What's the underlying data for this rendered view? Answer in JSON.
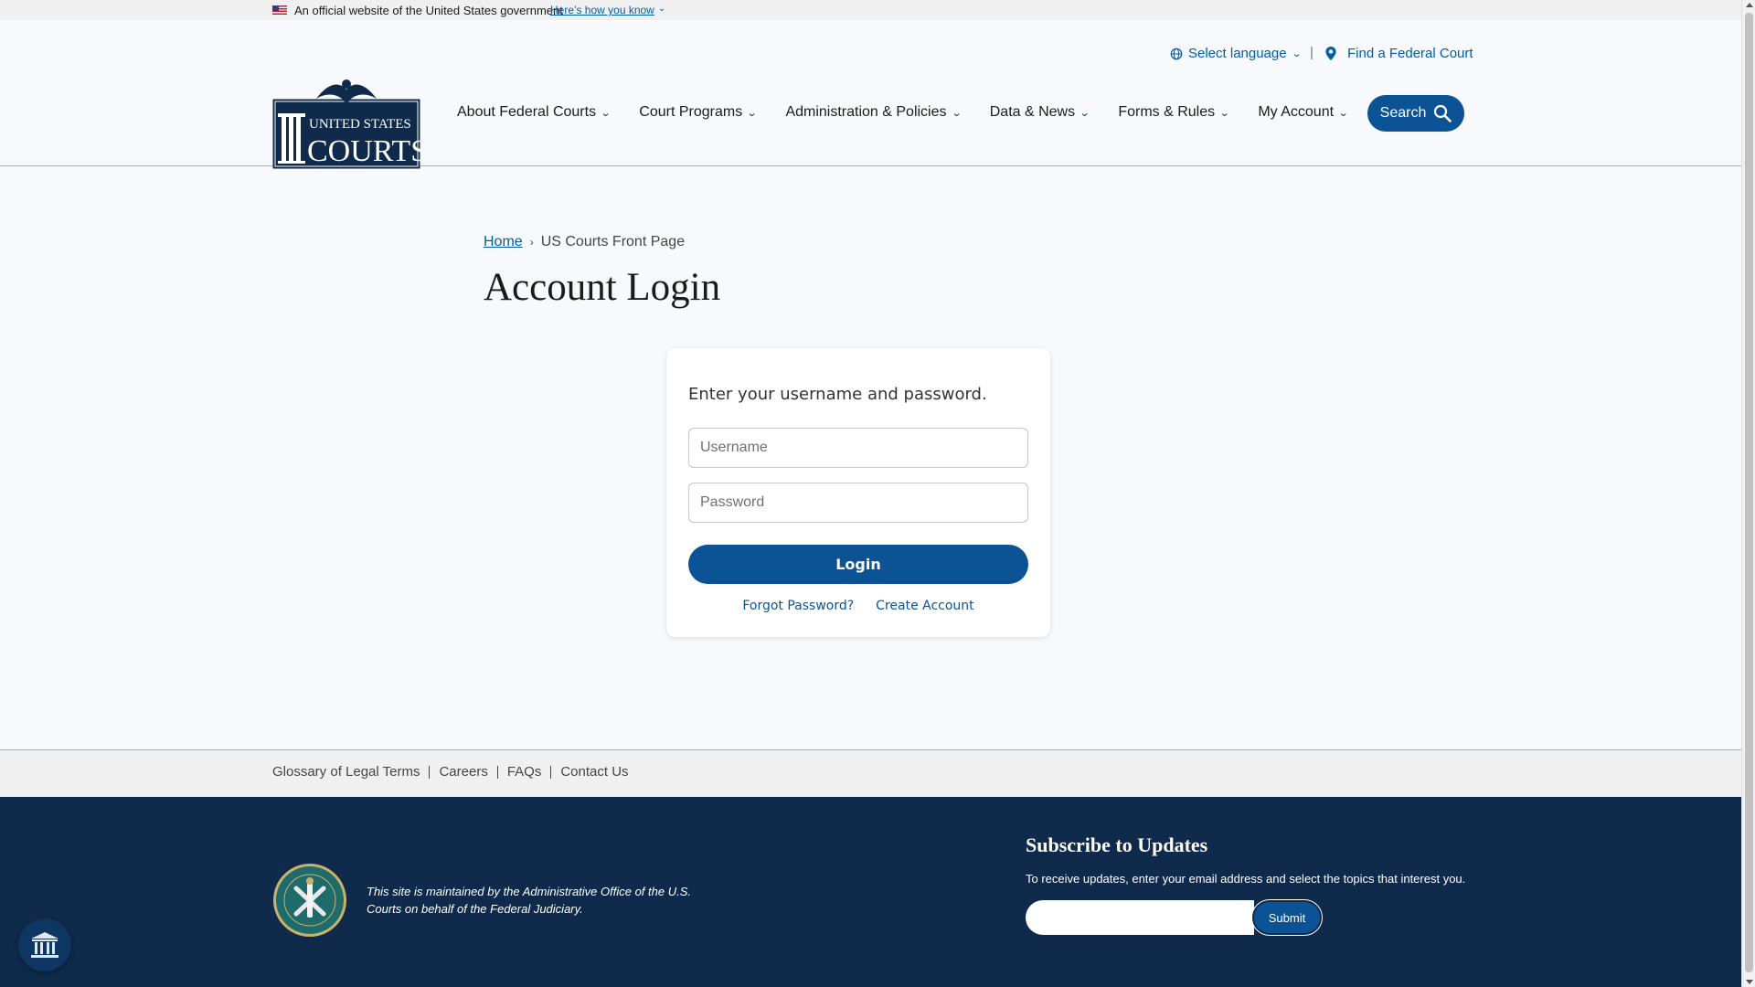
{
  "gov_banner": {
    "official_text": "An official website of the United States government",
    "how_link": "Here’s how you know"
  },
  "utility": {
    "language": "Select language",
    "find_court": "Find a Federal Court"
  },
  "logo": {
    "line1": "UNITED STATES",
    "line2": "COURTS"
  },
  "nav": {
    "items": [
      {
        "label": "About Federal Courts"
      },
      {
        "label": "Court Programs"
      },
      {
        "label": "Administration & Policies"
      },
      {
        "label": "Data & News"
      },
      {
        "label": "Forms & Rules"
      },
      {
        "label": "My Account"
      }
    ],
    "search_label": "Search"
  },
  "breadcrumb": {
    "home": "Home",
    "current": "US Courts Front Page"
  },
  "page": {
    "title": "Account Login"
  },
  "login": {
    "prompt": "Enter your username and password.",
    "username_placeholder": "Username",
    "username_value": "",
    "password_placeholder": "Password",
    "password_value": "",
    "login_label": "Login",
    "forgot_label": "Forgot Password?",
    "create_label": "Create Account"
  },
  "footer_links": {
    "items": [
      {
        "label": "Glossary of Legal Terms"
      },
      {
        "label": "Careers"
      },
      {
        "label": "FAQs"
      },
      {
        "label": "Contact Us"
      }
    ]
  },
  "footer": {
    "maintained_text": "This site is maintained by the Administrative Office of the U.S. Courts on behalf of the Federal Judiciary.",
    "subscribe_title": "Subscribe to Updates",
    "subscribe_text": "To receive updates, enter your email address and select the topics that interest you.",
    "email_value": "",
    "submit_label": "Submit"
  },
  "icons": {
    "flag": "us-flag-icon",
    "globe": "globe-icon",
    "pin": "map-pin-icon",
    "search": "search-icon",
    "chevron": "chevron-down-icon",
    "courthouse": "courthouse-icon"
  },
  "colors": {
    "primary": "#0b5394",
    "link": "#005ea2",
    "footer_bg": "#0f2a4a",
    "page_bg": "#f7f9fc"
  }
}
